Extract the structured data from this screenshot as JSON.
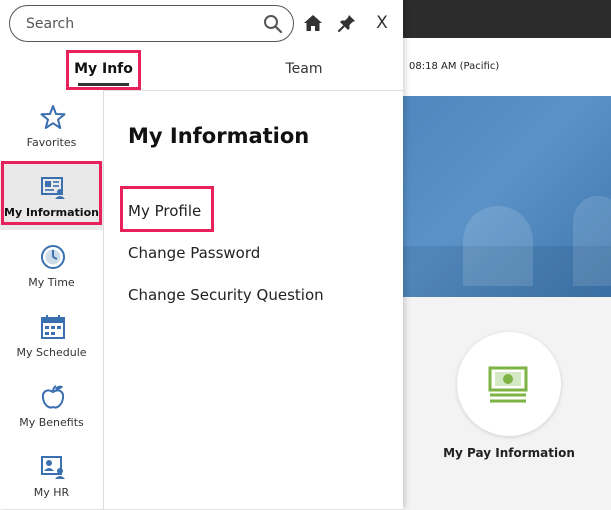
{
  "background": {
    "time_text": "08:18 AM (Pacific)",
    "tile": {
      "label": "My Pay Information",
      "icon": "pay-info-icon"
    }
  },
  "panel": {
    "search": {
      "placeholder": "Search",
      "icon": "search-icon"
    },
    "top_icons": [
      "home-icon",
      "pin-icon",
      "close-icon"
    ],
    "close_label": "X",
    "tabs": [
      {
        "label": "My Info",
        "selected": true
      },
      {
        "label": "Team",
        "selected": false
      }
    ],
    "nav": [
      {
        "label": "Favorites",
        "icon": "star-icon"
      },
      {
        "label": "My Information",
        "icon": "id-card-icon",
        "active": true
      },
      {
        "label": "My Time",
        "icon": "clock-icon"
      },
      {
        "label": "My Schedule",
        "icon": "calendar-icon"
      },
      {
        "label": "My Benefits",
        "icon": "apple-icon"
      },
      {
        "label": "My HR",
        "icon": "hr-icon"
      }
    ],
    "content": {
      "title": "My Information",
      "links": [
        "My Profile",
        "Change Password",
        "Change Security Question"
      ]
    }
  },
  "colors": {
    "highlight": "#e8215b",
    "accent_blue": "#3a6fb0",
    "pay_green": "#7cb342"
  }
}
